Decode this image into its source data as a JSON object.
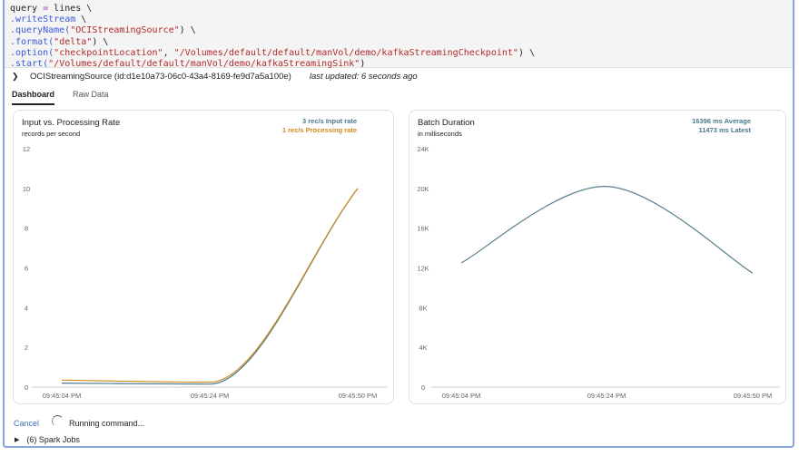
{
  "code": {
    "lines": [
      [
        [
          "plain",
          "query "
        ],
        [
          "op",
          "="
        ],
        [
          "plain",
          " lines \\"
        ]
      ],
      [
        [
          "kw",
          ".writeStream"
        ],
        [
          "plain",
          " \\"
        ]
      ],
      [
        [
          "kw",
          ".queryName("
        ],
        [
          "str",
          "\"OCIStreamingSource\""
        ],
        [
          "plain",
          ") \\"
        ]
      ],
      [
        [
          "kw",
          ".format("
        ],
        [
          "str",
          "\"delta\""
        ],
        [
          "plain",
          ") \\"
        ]
      ],
      [
        [
          "kw",
          ".option("
        ],
        [
          "str",
          "\"checkpointLocation\""
        ],
        [
          "plain",
          ", "
        ],
        [
          "str",
          "\"/Volumes/default/default/manVol/demo/kafkaStreamingCheckpoint\""
        ],
        [
          "plain",
          ") \\"
        ]
      ],
      [
        [
          "kw",
          ".start("
        ],
        [
          "str",
          "\"/Volumes/default/default/manVol/demo/kafkaStreamingSink\""
        ],
        [
          "plain",
          ")"
        ]
      ]
    ]
  },
  "stream": {
    "name": "OCIStreamingSource (id:d1e10a73-06c0-43a4-8169-fe9d7a5a100e)",
    "last_updated": "last updated: 6 seconds ago",
    "chevron_icon": "chevron-down-icon"
  },
  "tabs": [
    {
      "label": "Dashboard",
      "active": true
    },
    {
      "label": "Raw Data",
      "active": false
    }
  ],
  "colors": {
    "input": "#4a7a8c",
    "processing": "#d4891f",
    "duration": "#5a7f8c",
    "link": "#3b6fb6"
  },
  "chart_data": [
    {
      "type": "line",
      "title": "Input vs. Processing Rate",
      "subtitle": "records per second",
      "legend": [
        "3 rec/s Input rate",
        "1 rec/s Processing rate"
      ],
      "legend_placement": "top-right",
      "x": [
        "09:45:04 PM",
        "09:45:24 PM",
        "09:45:50 PM"
      ],
      "ylim": [
        0,
        12
      ],
      "yticks": [
        "0",
        "2",
        "4",
        "6",
        "8",
        "10",
        "12"
      ],
      "grid": false,
      "series": [
        {
          "name": "Input rate",
          "values": [
            0.2,
            0.15,
            10
          ]
        },
        {
          "name": "Processing rate",
          "values": [
            0.35,
            0.25,
            10
          ]
        }
      ]
    },
    {
      "type": "line",
      "title": "Batch Duration",
      "subtitle": "in milliseconds",
      "legend": [
        "16396 ms Average",
        "11473 ms Latest"
      ],
      "legend_placement": "top-right",
      "x": [
        "09:45:04 PM",
        "09:45:24 PM",
        "09:45:50 PM"
      ],
      "ylim": [
        0,
        24000
      ],
      "yticks": [
        "0",
        "4K",
        "8K",
        "12K",
        "16K",
        "20K",
        "24K"
      ],
      "grid": false,
      "series": [
        {
          "values": [
            12500,
            20200,
            11473
          ]
        }
      ]
    }
  ],
  "footer": {
    "cancel": "Cancel",
    "status": "Running command...",
    "jobs": "(6) Spark Jobs",
    "jobs_icon": "caret-right-icon"
  }
}
